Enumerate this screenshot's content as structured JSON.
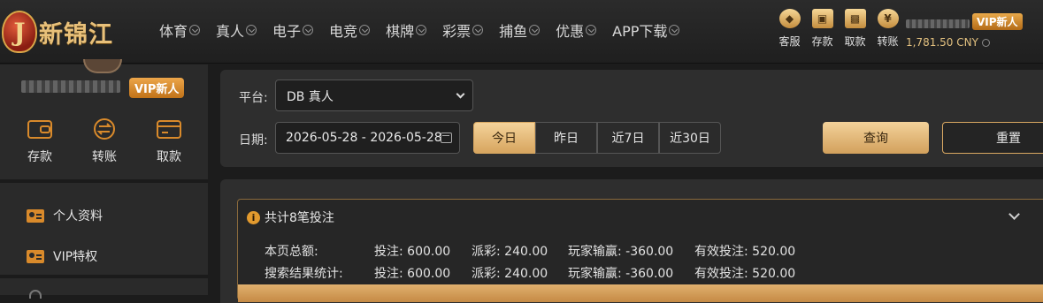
{
  "brand": {
    "logo_letter": "J",
    "name": "新锦江"
  },
  "nav": [
    {
      "label": "体育"
    },
    {
      "label": "真人"
    },
    {
      "label": "电子"
    },
    {
      "label": "电竞"
    },
    {
      "label": "棋牌"
    },
    {
      "label": "彩票"
    },
    {
      "label": "捕鱼"
    },
    {
      "label": "优惠"
    },
    {
      "label": "APP下载"
    }
  ],
  "quick_actions": [
    {
      "label": "客服",
      "icon": "customer-service-icon"
    },
    {
      "label": "存款",
      "icon": "wallet-icon"
    },
    {
      "label": "取款",
      "icon": "cash-icon"
    },
    {
      "label": "转账",
      "icon": "transfer-icon"
    }
  ],
  "user": {
    "vip_label": "VIP新人",
    "balance": "1,781.50 CNY"
  },
  "sidebar": {
    "vip_label": "VIP新人",
    "actions": [
      {
        "label": "存款",
        "icon": "wallet-icon"
      },
      {
        "label": "转账",
        "icon": "transfer-icon"
      },
      {
        "label": "取款",
        "icon": "card-icon"
      }
    ],
    "menu": [
      {
        "label": "个人资料",
        "icon": "profile-card-icon"
      },
      {
        "label": "VIP特权",
        "icon": "vip-card-icon"
      }
    ]
  },
  "filters": {
    "platform_label": "平台:",
    "platform_value": "DB 真人",
    "date_label": "日期:",
    "date_value": "2026-05-28  -  2026-05-28",
    "ranges": [
      "今日",
      "昨日",
      "近7日",
      "近30日"
    ],
    "active_range": "今日",
    "query_label": "查询",
    "reset_label": "重置"
  },
  "summary": {
    "title": "共计8笔投注",
    "rows": [
      {
        "label": "本页总额:",
        "bet": "投注: 600.00",
        "payout": "派彩: 240.00",
        "win_loss": "玩家输赢: -360.00",
        "valid_bet": "有效投注: 520.00"
      },
      {
        "label": "搜索结果统计:",
        "bet": "投注: 600.00",
        "payout": "派彩: 240.00",
        "win_loss": "玩家输赢: -360.00",
        "valid_bet": "有效投注: 520.00"
      }
    ]
  },
  "colors": {
    "accent_gold": "#d9a862",
    "vip_orange": "#e0902c",
    "background": "#1c1c1c",
    "panel": "#2e2e2e"
  }
}
